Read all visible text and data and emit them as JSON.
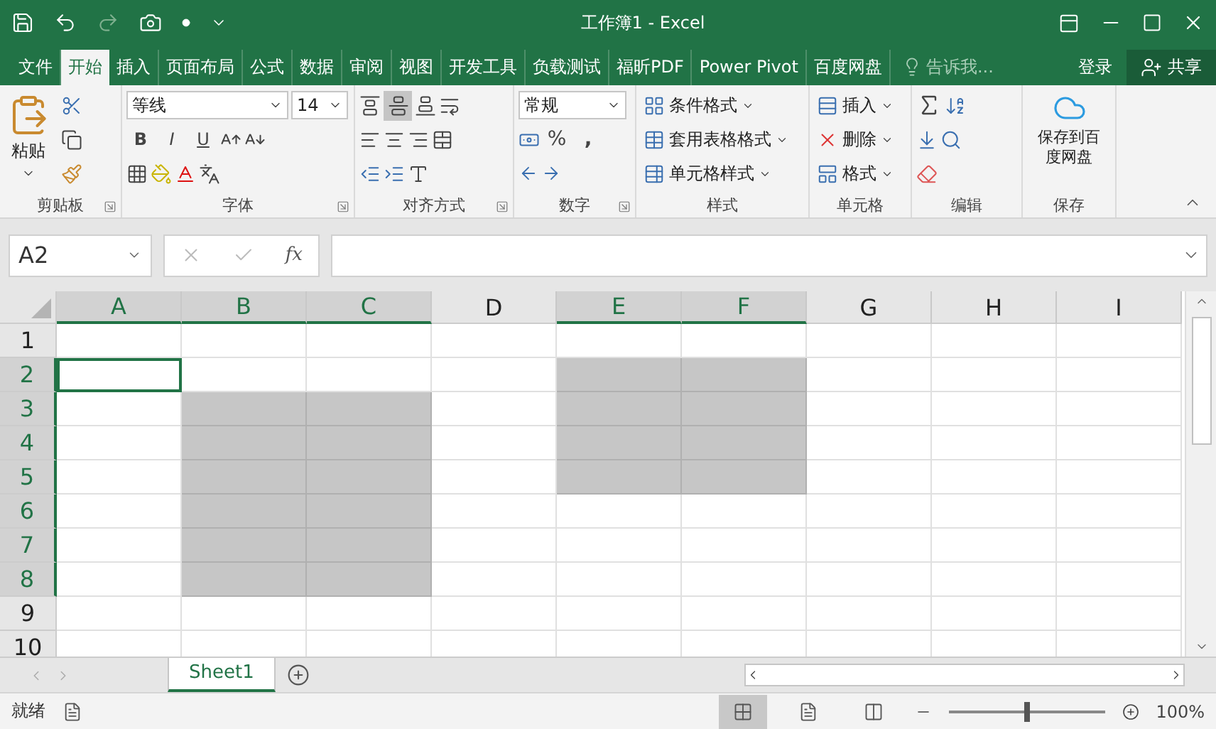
{
  "window": {
    "title": "工作簿1 - Excel"
  },
  "tabs": [
    {
      "label": "文件",
      "selected": false
    },
    {
      "label": "开始",
      "selected": true
    },
    {
      "label": "插入",
      "selected": false
    },
    {
      "label": "页面布局",
      "selected": false
    },
    {
      "label": "公式",
      "selected": false
    },
    {
      "label": "数据",
      "selected": false
    },
    {
      "label": "审阅",
      "selected": false
    },
    {
      "label": "视图",
      "selected": false
    },
    {
      "label": "开发工具",
      "selected": false
    },
    {
      "label": "负载测试",
      "selected": false
    },
    {
      "label": "福昕PDF",
      "selected": false
    },
    {
      "label": "Power Pivot",
      "selected": false
    },
    {
      "label": "百度网盘",
      "selected": false
    }
  ],
  "tell_me": {
    "placeholder": "告诉我..."
  },
  "sign_in": "登录",
  "share": "共享",
  "ribbon": {
    "clipboard": {
      "label": "剪贴板",
      "paste": "粘贴"
    },
    "font": {
      "label": "字体",
      "font_name": "等线",
      "font_size": "14",
      "styles": [
        "B",
        "I",
        "U"
      ]
    },
    "alignment": {
      "label": "对齐方式",
      "middle_align_selected": true
    },
    "number": {
      "label": "数字",
      "format": "常规",
      "percent": "%",
      "comma": ","
    },
    "styles": {
      "label": "样式",
      "items": [
        "条件格式",
        "套用表格格式",
        "单元格样式"
      ]
    },
    "cells": {
      "label": "单元格",
      "items": [
        "插入",
        "删除",
        "格式"
      ]
    },
    "editing": {
      "label": "编辑"
    },
    "save": {
      "label": "保存",
      "button": "保存到百度网盘"
    }
  },
  "formula_bar": {
    "name_box": "A2",
    "fx": "fx"
  },
  "columns": [
    {
      "label": "A",
      "selected": true
    },
    {
      "label": "B",
      "selected": true
    },
    {
      "label": "C",
      "selected": true
    },
    {
      "label": "D",
      "selected": false
    },
    {
      "label": "E",
      "selected": true
    },
    {
      "label": "F",
      "selected": true
    },
    {
      "label": "G",
      "selected": false
    },
    {
      "label": "H",
      "selected": false
    },
    {
      "label": "I",
      "selected": false
    }
  ],
  "rows": [
    {
      "label": "1",
      "selected": false,
      "cells": [
        {
          "selected": false,
          "active": false
        },
        {
          "selected": false,
          "active": false
        },
        {
          "selected": false,
          "active": false
        },
        {
          "selected": false,
          "active": false
        },
        {
          "selected": false,
          "active": false
        },
        {
          "selected": false,
          "active": false
        },
        {
          "selected": false,
          "active": false
        },
        {
          "selected": false,
          "active": false
        },
        {
          "selected": false,
          "active": false
        }
      ]
    },
    {
      "label": "2",
      "selected": true,
      "cells": [
        {
          "selected": false,
          "active": true
        },
        {
          "selected": false,
          "active": false
        },
        {
          "selected": false,
          "active": false
        },
        {
          "selected": false,
          "active": false
        },
        {
          "selected": true,
          "active": false
        },
        {
          "selected": true,
          "active": false
        },
        {
          "selected": false,
          "active": false
        },
        {
          "selected": false,
          "active": false
        },
        {
          "selected": false,
          "active": false
        }
      ]
    },
    {
      "label": "3",
      "selected": true,
      "cells": [
        {
          "selected": false,
          "active": false
        },
        {
          "selected": true,
          "active": false
        },
        {
          "selected": true,
          "active": false
        },
        {
          "selected": false,
          "active": false
        },
        {
          "selected": true,
          "active": false
        },
        {
          "selected": true,
          "active": false
        },
        {
          "selected": false,
          "active": false
        },
        {
          "selected": false,
          "active": false
        },
        {
          "selected": false,
          "active": false
        }
      ]
    },
    {
      "label": "4",
      "selected": true,
      "cells": [
        {
          "selected": false,
          "active": false
        },
        {
          "selected": true,
          "active": false
        },
        {
          "selected": true,
          "active": false
        },
        {
          "selected": false,
          "active": false
        },
        {
          "selected": true,
          "active": false
        },
        {
          "selected": true,
          "active": false
        },
        {
          "selected": false,
          "active": false
        },
        {
          "selected": false,
          "active": false
        },
        {
          "selected": false,
          "active": false
        }
      ]
    },
    {
      "label": "5",
      "selected": true,
      "cells": [
        {
          "selected": false,
          "active": false
        },
        {
          "selected": true,
          "active": false
        },
        {
          "selected": true,
          "active": false
        },
        {
          "selected": false,
          "active": false
        },
        {
          "selected": true,
          "active": false
        },
        {
          "selected": true,
          "active": false
        },
        {
          "selected": false,
          "active": false
        },
        {
          "selected": false,
          "active": false
        },
        {
          "selected": false,
          "active": false
        }
      ]
    },
    {
      "label": "6",
      "selected": true,
      "cells": [
        {
          "selected": false,
          "active": false
        },
        {
          "selected": true,
          "active": false
        },
        {
          "selected": true,
          "active": false
        },
        {
          "selected": false,
          "active": false
        },
        {
          "selected": false,
          "active": false
        },
        {
          "selected": false,
          "active": false
        },
        {
          "selected": false,
          "active": false
        },
        {
          "selected": false,
          "active": false
        },
        {
          "selected": false,
          "active": false
        }
      ]
    },
    {
      "label": "7",
      "selected": true,
      "cells": [
        {
          "selected": false,
          "active": false
        },
        {
          "selected": true,
          "active": false
        },
        {
          "selected": true,
          "active": false
        },
        {
          "selected": false,
          "active": false
        },
        {
          "selected": false,
          "active": false
        },
        {
          "selected": false,
          "active": false
        },
        {
          "selected": false,
          "active": false
        },
        {
          "selected": false,
          "active": false
        },
        {
          "selected": false,
          "active": false
        }
      ]
    },
    {
      "label": "8",
      "selected": true,
      "cells": [
        {
          "selected": false,
          "active": false
        },
        {
          "selected": true,
          "active": false
        },
        {
          "selected": true,
          "active": false
        },
        {
          "selected": false,
          "active": false
        },
        {
          "selected": false,
          "active": false
        },
        {
          "selected": false,
          "active": false
        },
        {
          "selected": false,
          "active": false
        },
        {
          "selected": false,
          "active": false
        },
        {
          "selected": false,
          "active": false
        }
      ]
    },
    {
      "label": "9",
      "selected": false,
      "cells": [
        {
          "selected": false,
          "active": false
        },
        {
          "selected": false,
          "active": false
        },
        {
          "selected": false,
          "active": false
        },
        {
          "selected": false,
          "active": false
        },
        {
          "selected": false,
          "active": false
        },
        {
          "selected": false,
          "active": false
        },
        {
          "selected": false,
          "active": false
        },
        {
          "selected": false,
          "active": false
        },
        {
          "selected": false,
          "active": false
        }
      ]
    },
    {
      "label": "10",
      "selected": false,
      "cells": [
        {
          "selected": false,
          "active": false
        },
        {
          "selected": false,
          "active": false
        },
        {
          "selected": false,
          "active": false
        },
        {
          "selected": false,
          "active": false
        },
        {
          "selected": false,
          "active": false
        },
        {
          "selected": false,
          "active": false
        },
        {
          "selected": false,
          "active": false
        },
        {
          "selected": false,
          "active": false
        },
        {
          "selected": false,
          "active": false
        }
      ]
    }
  ],
  "sheets": [
    {
      "label": "Sheet1",
      "selected": true
    }
  ],
  "status_bar": {
    "status": "就绪",
    "views": [
      {
        "selected": true
      },
      {
        "selected": false
      },
      {
        "selected": false
      }
    ],
    "zoom_level": {
      "level": 0.5
    },
    "zoom": "100%"
  }
}
